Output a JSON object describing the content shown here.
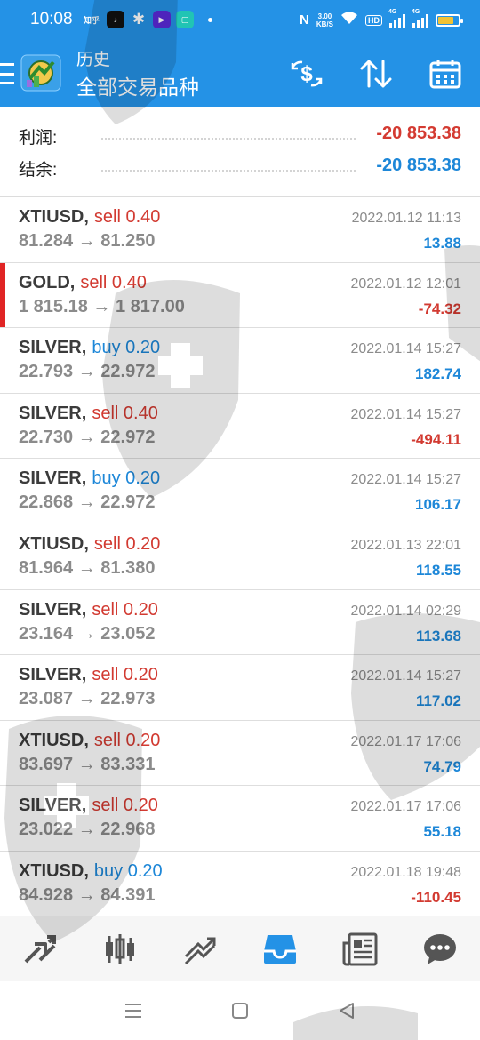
{
  "status_bar": {
    "time": "10:08",
    "left_icons": [
      "zhihu-icon",
      "tiktok-icon",
      "wechat-icon",
      "video-app-icon",
      "message-app-icon"
    ],
    "left_icon_text": "知乎",
    "net_speed_value": "3.00",
    "net_speed_unit": "KB/S",
    "hd_label": "HD",
    "signal_label": "4G",
    "battery_level": 0.75
  },
  "app_bar": {
    "title_small": "历史",
    "title_big": "全部交易品种",
    "actions": [
      "currency-filter-icon",
      "sort-icon",
      "calendar-icon"
    ]
  },
  "summary": {
    "profit_label": "利润:",
    "profit_value": "-20 853.38",
    "balance_label": "结余:",
    "balance_value": "-20 853.38"
  },
  "trades": [
    {
      "symbol": "XTIUSD",
      "side": "sell",
      "volume": "0.40",
      "open": "81.284",
      "close": "81.250",
      "time": "2022.01.12 11:13",
      "profit": "13.88",
      "profit_sign": "pos",
      "selected": false
    },
    {
      "symbol": "GOLD",
      "side": "sell",
      "volume": "0.40",
      "open": "1 815.18",
      "close": "1 817.00",
      "time": "2022.01.12 12:01",
      "profit": "-74.32",
      "profit_sign": "neg",
      "selected": true
    },
    {
      "symbol": "SILVER",
      "side": "buy",
      "volume": "0.20",
      "open": "22.793",
      "close": "22.972",
      "time": "2022.01.14 15:27",
      "profit": "182.74",
      "profit_sign": "pos",
      "selected": false
    },
    {
      "symbol": "SILVER",
      "side": "sell",
      "volume": "0.40",
      "open": "22.730",
      "close": "22.972",
      "time": "2022.01.14 15:27",
      "profit": "-494.11",
      "profit_sign": "neg",
      "selected": false
    },
    {
      "symbol": "SILVER",
      "side": "buy",
      "volume": "0.20",
      "open": "22.868",
      "close": "22.972",
      "time": "2022.01.14 15:27",
      "profit": "106.17",
      "profit_sign": "pos",
      "selected": false
    },
    {
      "symbol": "XTIUSD",
      "side": "sell",
      "volume": "0.20",
      "open": "81.964",
      "close": "81.380",
      "time": "2022.01.13 22:01",
      "profit": "118.55",
      "profit_sign": "pos",
      "selected": false
    },
    {
      "symbol": "SILVER",
      "side": "sell",
      "volume": "0.20",
      "open": "23.164",
      "close": "23.052",
      "time": "2022.01.14 02:29",
      "profit": "113.68",
      "profit_sign": "pos",
      "selected": false
    },
    {
      "symbol": "SILVER",
      "side": "sell",
      "volume": "0.20",
      "open": "23.087",
      "close": "22.973",
      "time": "2022.01.14 15:27",
      "profit": "117.02",
      "profit_sign": "pos",
      "selected": false
    },
    {
      "symbol": "XTIUSD",
      "side": "sell",
      "volume": "0.20",
      "open": "83.697",
      "close": "83.331",
      "time": "2022.01.17 17:06",
      "profit": "74.79",
      "profit_sign": "pos",
      "selected": false
    },
    {
      "symbol": "SILVER",
      "side": "sell",
      "volume": "0.20",
      "open": "23.022",
      "close": "22.968",
      "time": "2022.01.17 17:06",
      "profit": "55.18",
      "profit_sign": "pos",
      "selected": false
    },
    {
      "symbol": "XTIUSD",
      "side": "buy",
      "volume": "0.20",
      "open": "84.928",
      "close": "84.391",
      "time": "2022.01.18 19:48",
      "profit": "-110.45",
      "profit_sign": "neg",
      "selected": false
    }
  ],
  "bottom_nav": {
    "items": [
      "quotes-icon",
      "chart-candles-icon",
      "trade-icon",
      "history-inbox-icon",
      "news-icon",
      "chat-icon"
    ],
    "active": "history-inbox-icon"
  },
  "system_nav": {
    "items": [
      "recents-icon",
      "home-icon",
      "back-icon"
    ]
  },
  "colors": {
    "header_blue": "#2492e6",
    "loss_red": "#d23a31",
    "profit_blue": "#1d87d8",
    "active_nav": "#2492e6",
    "inactive_nav": "#555555"
  }
}
